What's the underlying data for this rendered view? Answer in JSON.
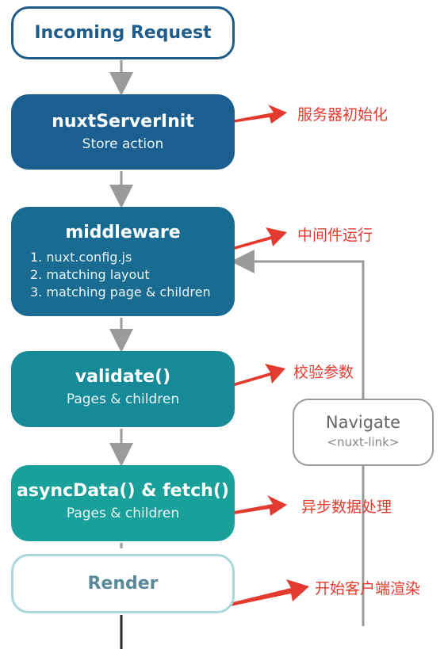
{
  "nodes": {
    "request": {
      "title": "Incoming Request"
    },
    "init": {
      "title": "nuxtServerInit",
      "subtitle": "Store action"
    },
    "middleware": {
      "title": "middleware",
      "items": [
        "1. nuxt.config.js",
        "2. matching layout",
        "3. matching page & children"
      ]
    },
    "validate": {
      "title": "validate()",
      "subtitle": "Pages & children"
    },
    "async": {
      "title": "asyncData() & fetch()",
      "subtitle": "Pages & children"
    },
    "render": {
      "title": "Render"
    },
    "navigate": {
      "title": "Navigate",
      "subtitle": "<nuxt-link>"
    }
  },
  "annotations": {
    "init": "服务器初始化",
    "middleware": "中间件运行",
    "validate": "校验参数",
    "async": "异步数据处理",
    "render": "开始客户端渲染"
  },
  "colors": {
    "init": "#1a5f8f",
    "middleware": "#1a6b91",
    "validate": "#178a97",
    "async": "#1aa09a",
    "arrow_red": "#e23a2e",
    "connector": "#9a9a9a"
  }
}
